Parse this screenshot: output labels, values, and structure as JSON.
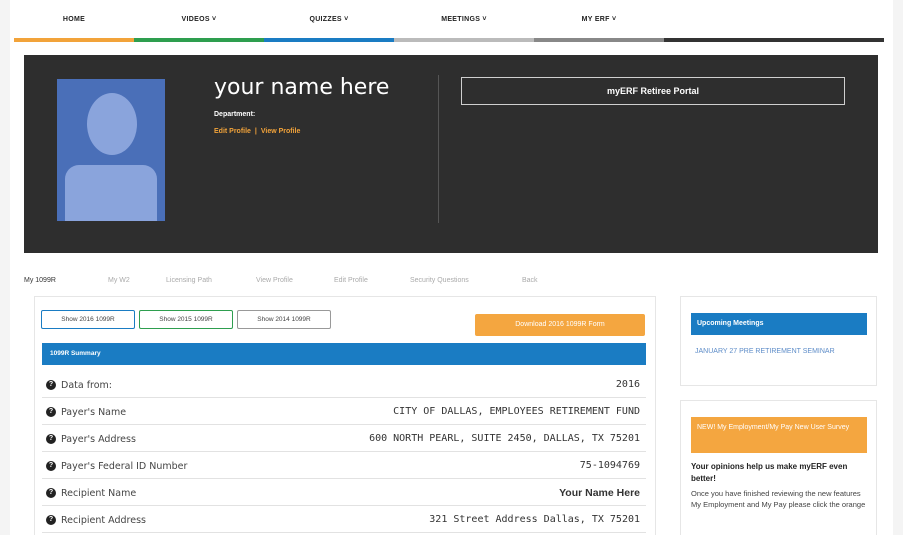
{
  "nav": {
    "items": [
      {
        "label": "HOME",
        "color": "#f2a33a"
      },
      {
        "label": "VIDEOS ˅",
        "color": "#2e9e4f"
      },
      {
        "label": "QUIZZES ˅",
        "color": "#1a7cc3"
      },
      {
        "label": "MEETINGS ˅",
        "color": "#bbbbbb"
      },
      {
        "label": "MY ERF ˅",
        "color": "#888888"
      }
    ],
    "trailing_color": "#333333"
  },
  "profile": {
    "name": "your name here",
    "department": "Department:",
    "edit_profile": "Edit Profile",
    "view_profile": "View Profile",
    "separator": "|",
    "portal_title": "myERF Retiree Portal"
  },
  "tabs": [
    {
      "label": "My 1099R",
      "active": true
    },
    {
      "label": "My W2",
      "active": false
    },
    {
      "label": "Licensing Path",
      "active": false
    },
    {
      "label": "View Profile",
      "active": false
    },
    {
      "label": "Edit Profile",
      "active": false
    },
    {
      "label": "Security Questions",
      "active": false
    },
    {
      "label": "Back",
      "active": false
    }
  ],
  "form1099": {
    "year_buttons": [
      "Show 2016 1099R",
      "Show 2015 1099R",
      "Show 2014 1099R"
    ],
    "download_label": "Download 2016 1099R Form",
    "summary_title": "1099R Summary",
    "rows": [
      {
        "label": "Data from:",
        "value": "2016"
      },
      {
        "label": "Payer's Name",
        "value": "CITY OF DALLAS, EMPLOYEES RETIREMENT FUND"
      },
      {
        "label": "Payer's Address",
        "value": "600 NORTH PEARL, SUITE 2450, DALLAS, TX 75201"
      },
      {
        "label": "Payer's Federal ID Number",
        "value": "75-1094769"
      },
      {
        "label": "Recipient Name",
        "value": "Your Name Here"
      },
      {
        "label": "Recipient Address",
        "value": "321 Street Address Dallas, TX 75201"
      }
    ]
  },
  "sidebar": {
    "meetings_title": "Upcoming Meetings",
    "meetings_link": "JANUARY 27 PRE RETIREMENT SEMINAR",
    "survey_title": "NEW! My Employment/My Pay New User Survey",
    "survey_heading": "Your opinions help us make myERF even better!",
    "survey_body": "Once you have finished reviewing the new features My Employment and My Pay please click the orange"
  },
  "colors": {
    "accent_orange": "#f4a640",
    "accent_blue": "#1a7cc3",
    "hero_bg": "#2e2e2e"
  }
}
